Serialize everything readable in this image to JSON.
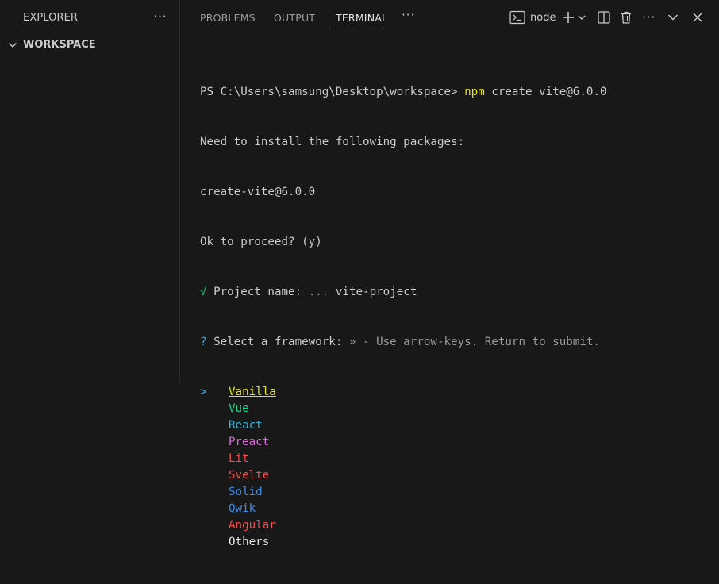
{
  "sidebar": {
    "title": "EXPLORER",
    "more_icon": "ellipsis-icon",
    "workspace_label": "WORKSPACE"
  },
  "panel": {
    "tabs": [
      {
        "label": "PROBLEMS",
        "active": false
      },
      {
        "label": "OUTPUT",
        "active": false
      },
      {
        "label": "TERMINAL",
        "active": true
      }
    ],
    "toolbar": {
      "terminal_name": "node",
      "icons": [
        "terminal-icon",
        "plus-icon",
        "chevron-down-icon",
        "split-icon",
        "trash-icon",
        "ellipsis-icon",
        "chevron-down-icon",
        "close-icon"
      ]
    }
  },
  "terminal": {
    "prompt": "PS C:\\Users\\samsung\\Desktop\\workspace>",
    "command": "npm",
    "command_args": "create vite@6.0.0",
    "line2": "Need to install the following packages:",
    "line3": "create-vite@6.0.0",
    "line4": "Ok to proceed? (y)",
    "check_mark": "√",
    "project_label": "Project name:",
    "project_sep": "...",
    "project_value": "vite-project",
    "q_mark": "?",
    "framework_label": "Select a framework:",
    "framework_hint": "» - Use arrow-keys. Return to submit.",
    "cursor": ">",
    "frameworks": [
      {
        "label": "Vanilla",
        "color": "#e5e510",
        "selected": true
      },
      {
        "label": "Vue",
        "color": "#23d18b"
      },
      {
        "label": "React",
        "color": "#29b8db"
      },
      {
        "label": "Preact",
        "color": "#d670d6"
      },
      {
        "label": "Lit",
        "color": "#f14c4c"
      },
      {
        "label": "Svelte",
        "color": "#f14c4c"
      },
      {
        "label": "Solid",
        "color": "#3b8eea"
      },
      {
        "label": "Qwik",
        "color": "#3b8eea"
      },
      {
        "label": "Angular",
        "color": "#f14c4c"
      },
      {
        "label": "Others",
        "color": "#e5e5e5"
      }
    ]
  },
  "colors": {
    "background": "#181818",
    "text": "#cccccc",
    "accent_yellow": "#e5e510",
    "accent_green": "#23d18b"
  }
}
